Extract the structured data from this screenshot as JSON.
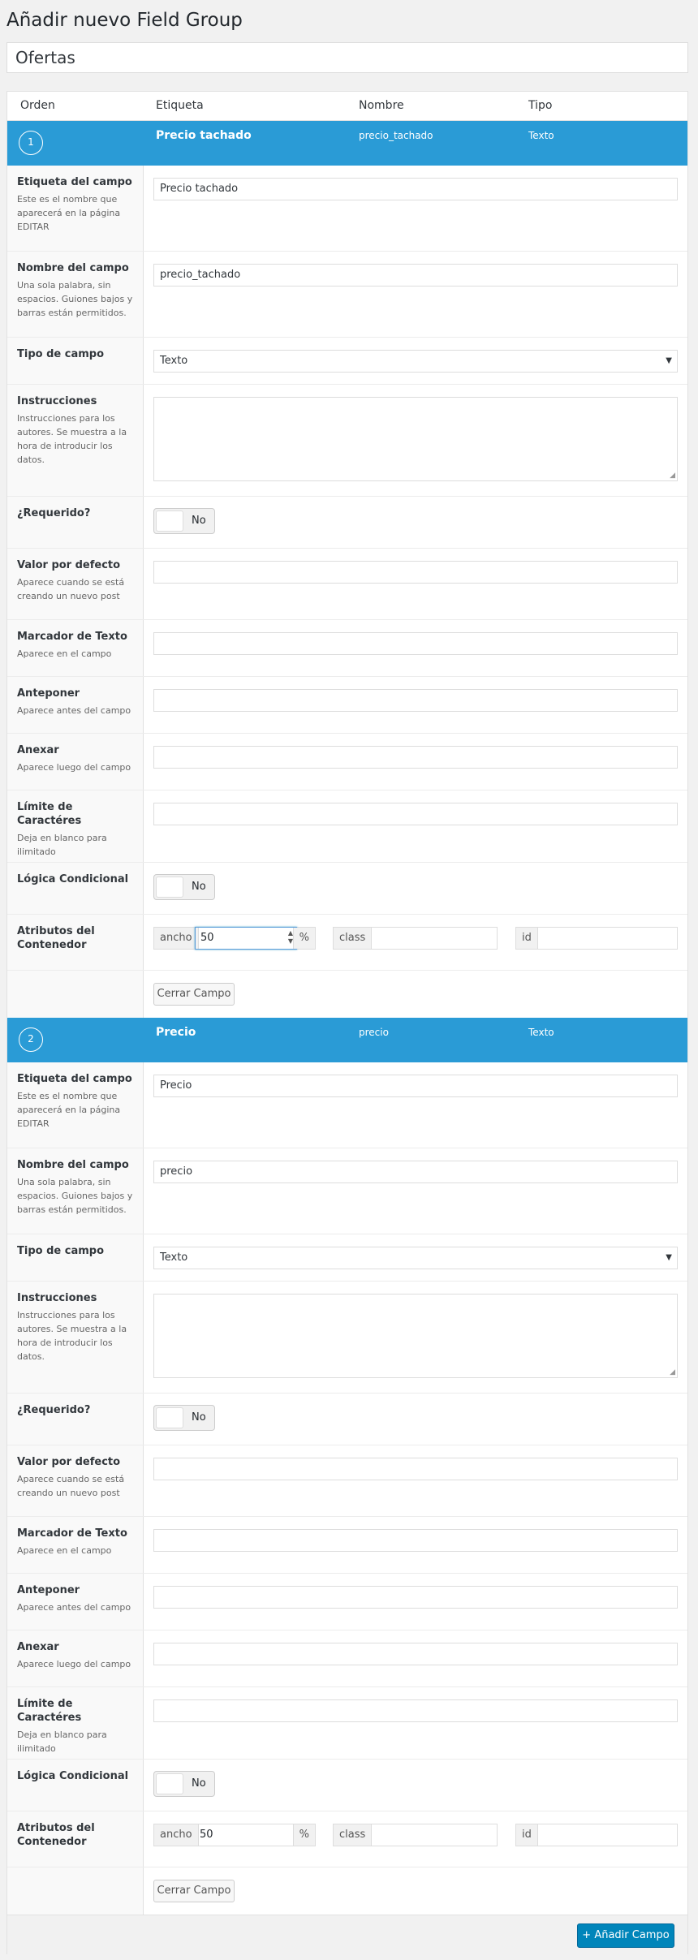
{
  "page_title": "Añadir nuevo Field Group",
  "group_title": "Ofertas",
  "columns": {
    "order": "Orden",
    "label": "Etiqueta",
    "name": "Nombre",
    "type": "Tipo"
  },
  "labels": {
    "etiqueta": "Etiqueta del campo",
    "etiqueta_desc": "Este es el nombre que aparecerá en la página EDITAR",
    "nombre": "Nombre del campo",
    "nombre_desc": "Una sola palabra, sin espacios. Guiones bajos y barras están permitidos.",
    "tipo": "Tipo de campo",
    "instrucciones": "Instrucciones",
    "instrucciones_desc": "Instrucciones para los autores. Se muestra a la hora de introducir los datos.",
    "requerido": "¿Requerido?",
    "valor": "Valor por defecto",
    "valor_desc": "Aparece cuando se está creando un nuevo post",
    "marcador": "Marcador de Texto",
    "marcador_desc": "Aparece en el campo",
    "anteponer": "Anteponer",
    "anteponer_desc": "Aparece antes del campo",
    "anexar": "Anexar",
    "anexar_desc": "Aparece luego del campo",
    "limite": "Límite de Caractéres",
    "limite_desc": "Deja en blanco para ilimitado",
    "logica": "Lógica Condicional",
    "atributos": "Atributos del Contenedor",
    "toggle_no": "No",
    "ancho": "ancho",
    "percent": "%",
    "class": "class",
    "id": "id",
    "close": "Cerrar Campo"
  },
  "fields": [
    {
      "order": "1",
      "label": "Precio tachado",
      "name": "precio_tachado",
      "type": "Texto",
      "width": "50"
    },
    {
      "order": "2",
      "label": "Precio",
      "name": "precio",
      "type": "Texto",
      "width": "50"
    }
  ],
  "add_button": "+ Añadir Campo",
  "colors": {
    "accent": "#2a9bd6",
    "button": "#0085ba"
  }
}
